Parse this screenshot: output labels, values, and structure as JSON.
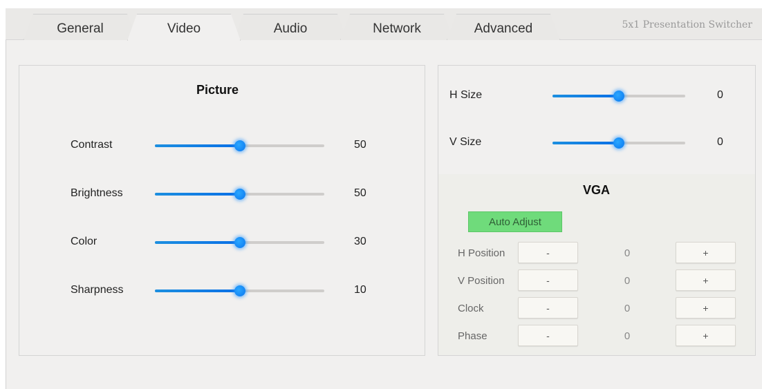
{
  "tabs": [
    "General",
    "Video",
    "Audio",
    "Network",
    "Advanced"
  ],
  "active_tab": "Video",
  "product_name": "5x1 Presentation Switcher",
  "picture": {
    "title": "Picture",
    "rows": [
      {
        "label": "Contrast",
        "value": "50",
        "level": 0.5
      },
      {
        "label": "Brightness",
        "value": "50",
        "level": 0.5
      },
      {
        "label": "Color",
        "value": "30",
        "level": 0.5
      },
      {
        "label": "Sharpness",
        "value": "10",
        "level": 0.5
      }
    ]
  },
  "size": {
    "rows": [
      {
        "label": "H Size",
        "value": "0",
        "level": 0.5
      },
      {
        "label": "V Size",
        "value": "0",
        "level": 0.5
      }
    ]
  },
  "vga": {
    "title": "VGA",
    "auto_adjust_label": "Auto Adjust",
    "minus_label": "-",
    "plus_label": "+",
    "rows": [
      {
        "label": "H Position",
        "value": "0"
      },
      {
        "label": "V Position",
        "value": "0"
      },
      {
        "label": "Clock",
        "value": "0"
      },
      {
        "label": "Phase",
        "value": "0"
      }
    ]
  },
  "colors": {
    "accent": "#0a76ef",
    "auto_adjust": "#6fdb7b",
    "background": "#f1f0ef"
  }
}
